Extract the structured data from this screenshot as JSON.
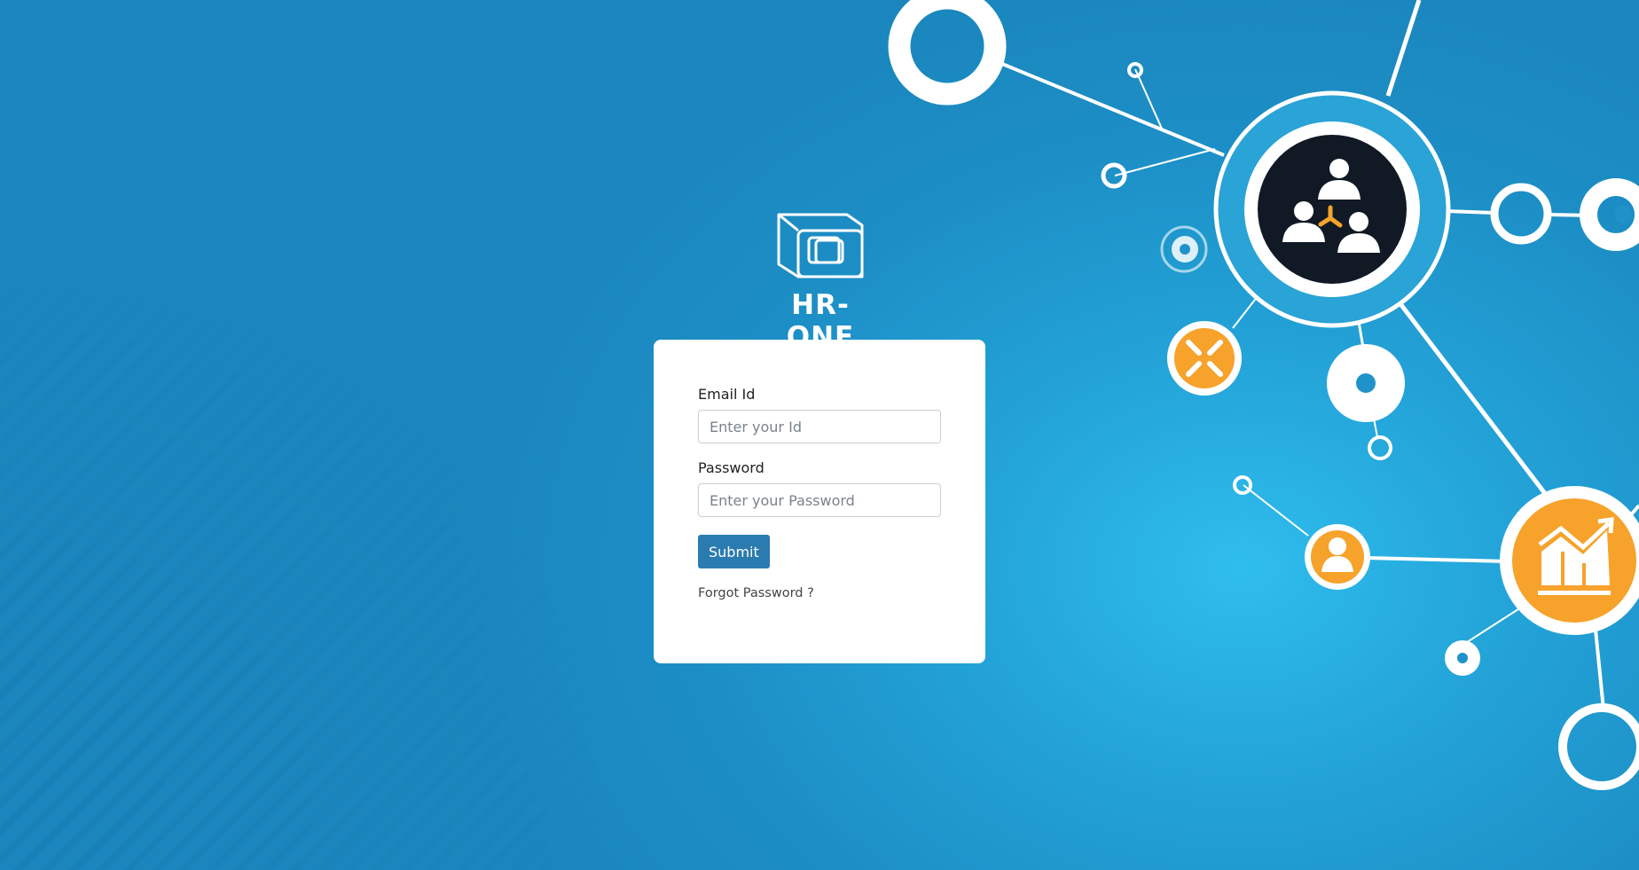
{
  "brand": {
    "name": "HR-ONE",
    "logo_icon": "hr-one-logo-icon"
  },
  "login": {
    "email_label": "Email Id",
    "email_placeholder": "Enter your Id",
    "email_value": "",
    "password_label": "Password",
    "password_placeholder": "Enter your Password",
    "password_value": "",
    "submit_label": "Submit",
    "forgot_label": "Forgot Password ?"
  },
  "illustration": {
    "icons": [
      "team-network-icon",
      "compress-arrows-icon",
      "user-icon",
      "growth-chart-icon"
    ],
    "colors": {
      "background": "#1c8ec5",
      "accent": "#f6a22b",
      "dark_node": "#111a24",
      "button": "#2a7bb0"
    }
  }
}
